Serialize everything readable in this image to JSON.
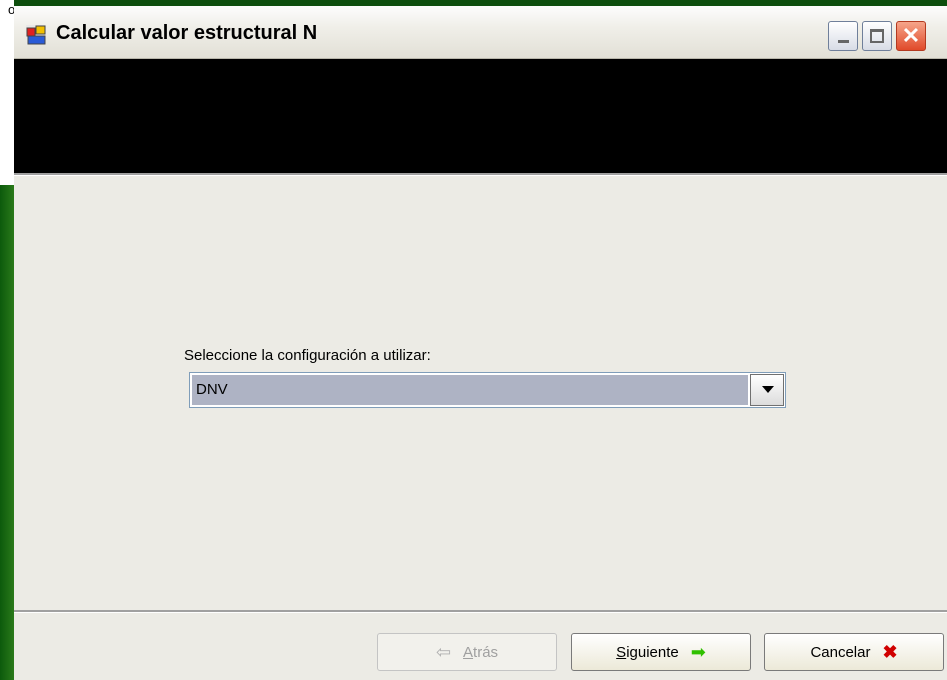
{
  "background": {
    "fragment": "o"
  },
  "window": {
    "title": "Calcular valor estructural N",
    "icon": "app-window-icon",
    "buttons": {
      "minimize": "minimize-icon",
      "maximize": "maximize-icon",
      "close": "close-icon"
    }
  },
  "main": {
    "prompt": "Seleccione la configuración a utilizar:",
    "config_select": {
      "value": "DNV"
    }
  },
  "footer": {
    "back": {
      "pre": "",
      "mnemonic": "A",
      "rest": "trás",
      "icon": "arrow-left-icon"
    },
    "next": {
      "mnemonic": "S",
      "rest": "iguiente",
      "icon": "arrow-right-icon"
    },
    "cancel": {
      "label": "Cancelar",
      "icon": "cancel-x-icon"
    }
  },
  "colors": {
    "header_band": "#000000",
    "dialog_bg": "#ecebe5",
    "select_bg": "#aeb3c4"
  }
}
